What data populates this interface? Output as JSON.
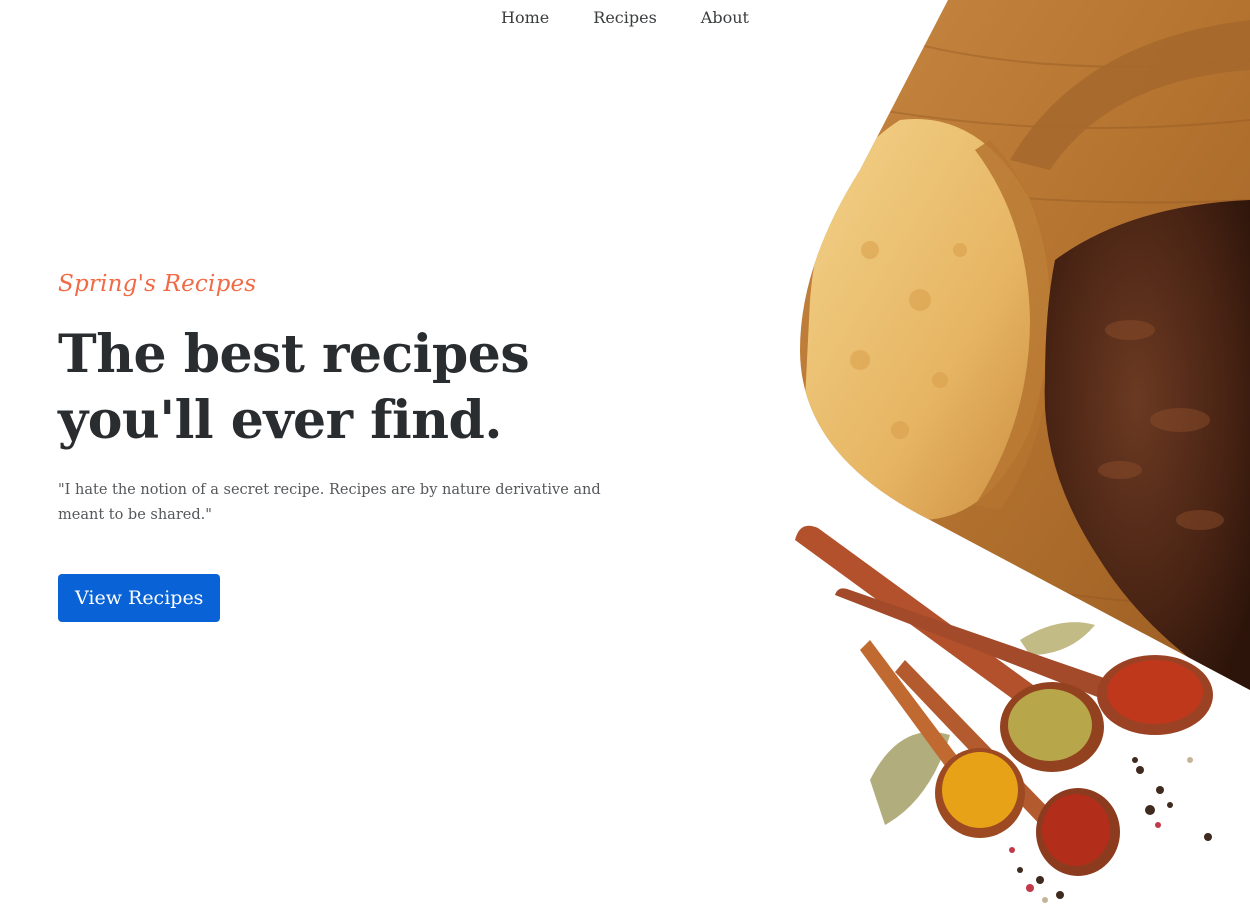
{
  "nav": {
    "items": [
      {
        "label": "Home"
      },
      {
        "label": "Recipes"
      },
      {
        "label": "About"
      }
    ]
  },
  "hero": {
    "eyebrow": "Spring's Recipes",
    "headline": "The best recipes you'll ever find.",
    "quote": "\"I hate the notion of a secret recipe. Recipes are by nature derivative and meant to be shared.\"",
    "cta_label": "View Recipes"
  },
  "colors": {
    "accent": "#f06a45",
    "button": "#0a63d6",
    "heading": "#2a2d30",
    "body_text": "#55585b"
  },
  "images": {
    "main_photo": "steak-and-potato-photo",
    "secondary_photo": "spice-spoons-photo"
  }
}
